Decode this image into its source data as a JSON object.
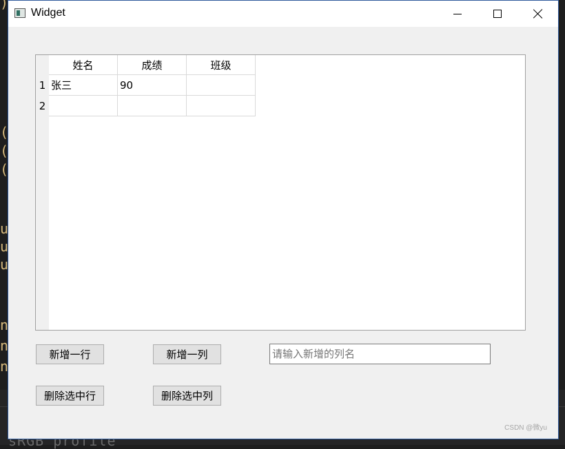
{
  "background": {
    "left_glyphs": [
      ")",
      "(",
      "(",
      "(",
      "u",
      "u",
      "u",
      "n",
      "n",
      "n"
    ],
    "bottom_text": "sRGB profile"
  },
  "window": {
    "title": "Widget",
    "controls": {
      "minimize": "minimize-icon",
      "maximize": "maximize-icon",
      "close": "close-icon"
    }
  },
  "table": {
    "headers": [
      "姓名",
      "成绩",
      "班级"
    ],
    "row_numbers": [
      "1",
      "2"
    ],
    "rows": [
      [
        "张三",
        "90",
        ""
      ],
      [
        "",
        "",
        ""
      ]
    ]
  },
  "controls": {
    "add_row": "新增一行",
    "add_column": "新增一列",
    "column_name_value": "",
    "column_name_placeholder": "请输入新增的列名",
    "delete_row": "删除选中行",
    "delete_column": "删除选中列"
  },
  "watermark": "CSDN @微yu"
}
